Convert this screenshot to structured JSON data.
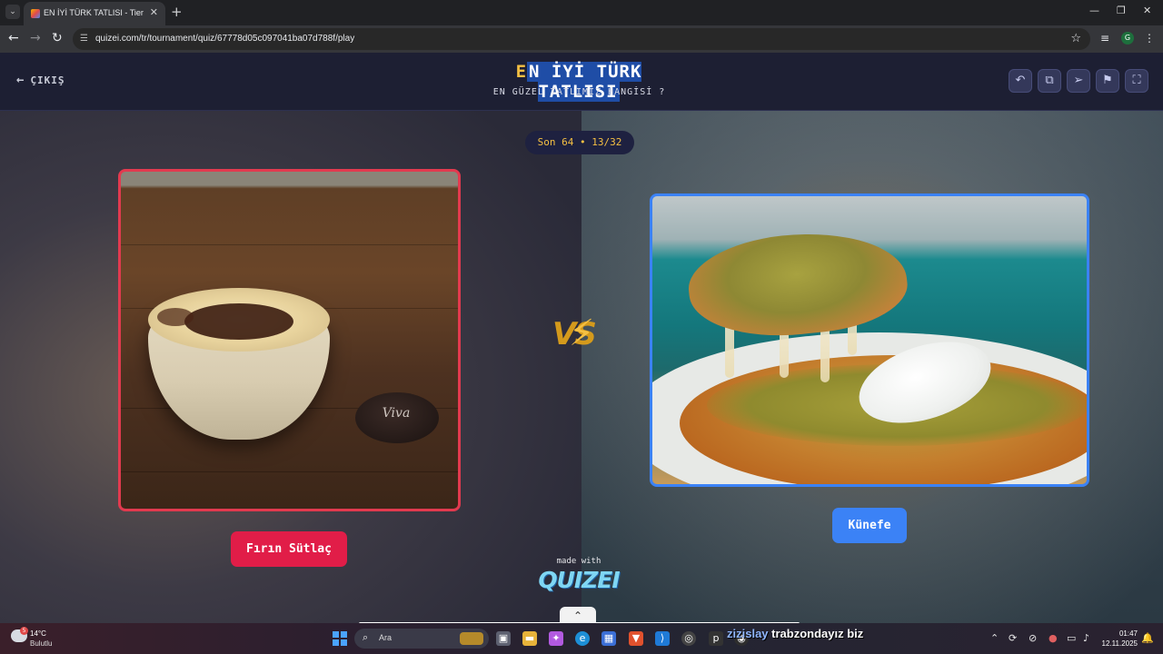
{
  "browser": {
    "tab_title": "EN İYİ TÜRK TATLISI - Tier List, Q",
    "url": "quizei.com/tr/tournament/quiz/67778d05c097041ba07d788f/play",
    "profile_initial": "G"
  },
  "quiz": {
    "exit_label": "ÇIKIŞ",
    "title_first_letter": "E",
    "title_rest": "N İYİ TÜRK TATLISI",
    "subtitle": "EN GÜZEL TATLIMIZ HANGİSİ ?",
    "round_label": "Son 64 • 13/32",
    "vs_label": "VS",
    "left_choice": "Fırın Sütlaç",
    "right_choice": "Künefe",
    "left_image_logo": "Viva",
    "made_with": "made with",
    "brand": "QUIZEI"
  },
  "taskbar": {
    "temperature": "14°C",
    "condition": "Bulutlu",
    "weather_badge": "5",
    "search_placeholder": "Ara",
    "overlay_user": "zizislay",
    "overlay_text": " trabzondayız biz",
    "time": "01:47",
    "date": "12.11.2025"
  },
  "colors": {
    "accent_red": "#e11d48",
    "accent_blue": "#3b82f6",
    "title_highlight": "#1f4da6",
    "gold": "#f5c043"
  }
}
